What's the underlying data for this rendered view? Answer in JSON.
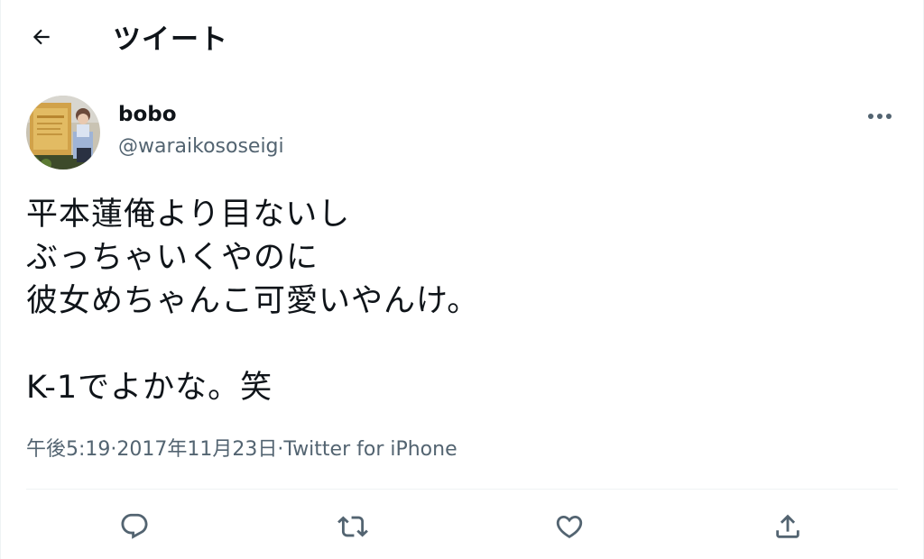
{
  "header": {
    "title": "ツイート",
    "back_icon": "arrow-left-icon"
  },
  "author": {
    "display_name": "bobo",
    "handle": "@waraikososeigi",
    "more_icon": "more-horizontal-icon"
  },
  "tweet": {
    "lines": [
      "平本蓮俺より目ないし",
      "ぶっちゃいくやのに",
      "彼女めちゃんこ可愛いやんけ。",
      "",
      "K-1でよかな。笑"
    ]
  },
  "meta": {
    "time": "午後5:19",
    "separator": " · ",
    "date": "2017年11月23日",
    "source": "Twitter for iPhone"
  },
  "actions": [
    {
      "name": "reply",
      "icon": "reply-icon"
    },
    {
      "name": "retweet",
      "icon": "retweet-icon"
    },
    {
      "name": "like",
      "icon": "heart-icon"
    },
    {
      "name": "share",
      "icon": "share-icon"
    }
  ],
  "colors": {
    "text_primary": "#0f1419",
    "text_secondary": "#536471",
    "divider": "#eff3f4",
    "background": "#ffffff"
  }
}
